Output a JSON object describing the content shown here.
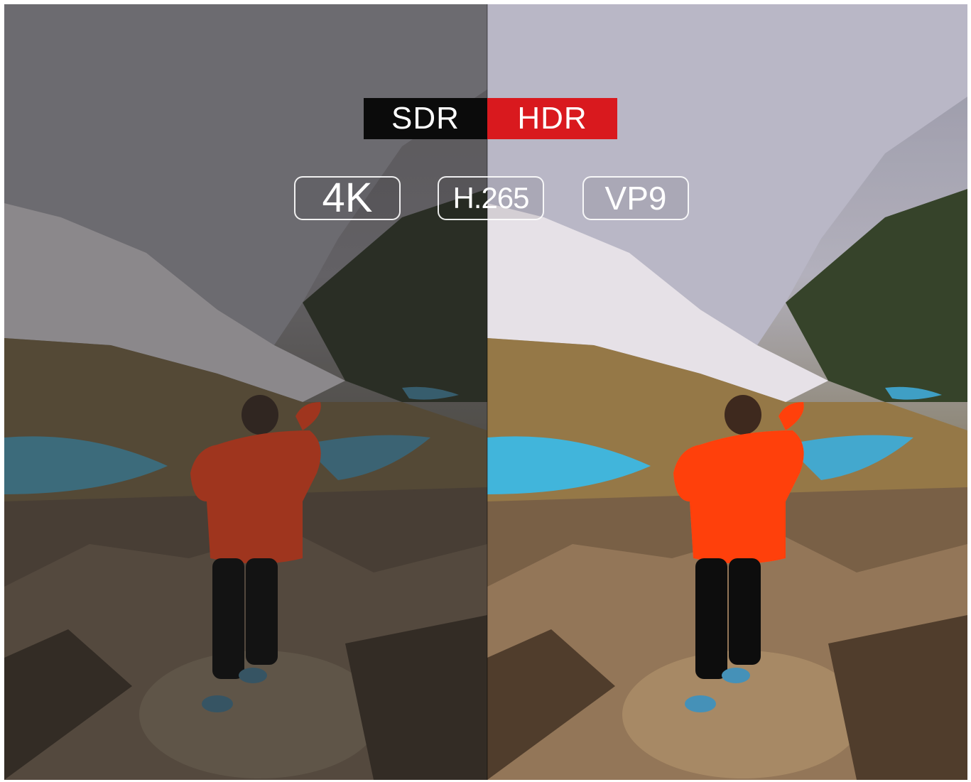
{
  "labels": {
    "left": "SDR",
    "right": "HDR"
  },
  "codecs": [
    "4K",
    "H.265",
    "VP9"
  ],
  "colors": {
    "sdr_label_bg": "#0b0b0b",
    "hdr_label_bg": "#d9191e",
    "jacket": "#e23a15"
  }
}
